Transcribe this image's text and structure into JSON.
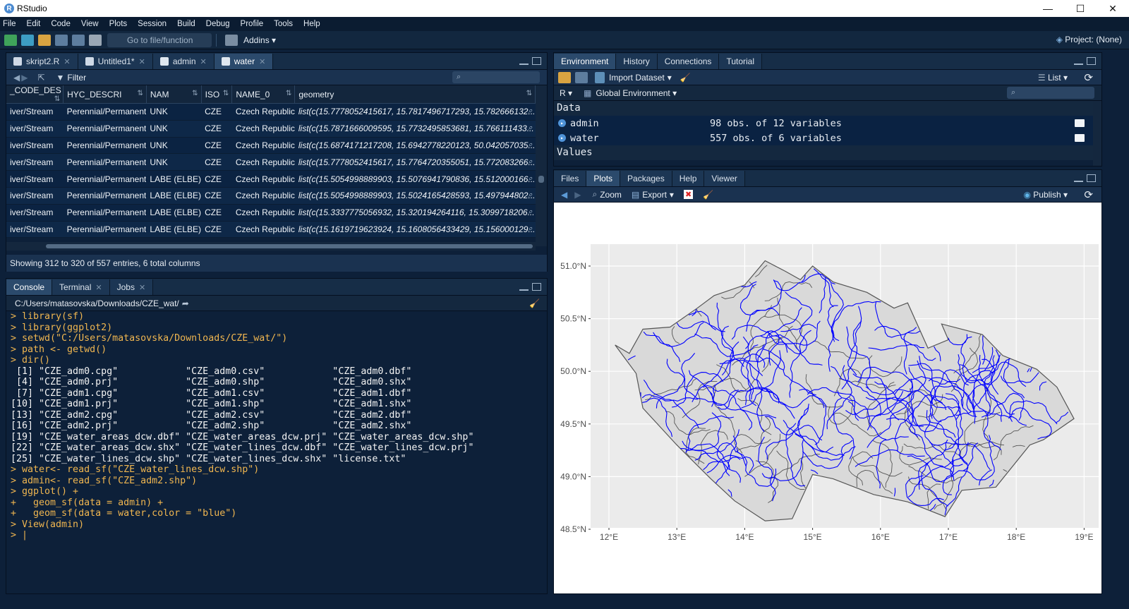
{
  "window": {
    "title": "RStudio",
    "controls": [
      "—",
      "☐",
      "✕"
    ]
  },
  "menu": [
    "File",
    "Edit",
    "Code",
    "View",
    "Plots",
    "Session",
    "Build",
    "Debug",
    "Profile",
    "Tools",
    "Help"
  ],
  "toolbar": {
    "goto_placeholder": "Go to file/function",
    "addins": "Addins",
    "project": "Project: (None)"
  },
  "source": {
    "tabs": [
      {
        "label": "skript2.R",
        "icon": "r-file-icon"
      },
      {
        "label": "Untitled1*",
        "icon": "r-file-icon"
      },
      {
        "label": "admin",
        "icon": "table-icon"
      },
      {
        "label": "water",
        "icon": "table-icon"
      }
    ],
    "active_tab": 3,
    "filter_label": "Filter",
    "columns": [
      "_CODE_DES",
      "HYC_DESCRI",
      "NAM",
      "ISO",
      "NAME_0",
      "geometry"
    ],
    "rows": [
      [
        "iver/Stream",
        "Perennial/Permanent",
        "UNK",
        "CZE",
        "Czech Republic",
        "list(c(15.7778052415617, 15.7817496717293, 15.782666132..."
      ],
      [
        "iver/Stream",
        "Perennial/Permanent",
        "UNK",
        "CZE",
        "Czech Republic",
        "list(c(15.7871666009595, 15.7732495853681, 15.766111433..."
      ],
      [
        "iver/Stream",
        "Perennial/Permanent",
        "UNK",
        "CZE",
        "Czech Republic",
        "list(c(15.6874171217208, 15.6942778220123, 50.042057035..."
      ],
      [
        "iver/Stream",
        "Perennial/Permanent",
        "UNK",
        "CZE",
        "Czech Republic",
        "list(c(15.7778052415617, 15.7764720355051, 15.772083266..."
      ],
      [
        "iver/Stream",
        "Perennial/Permanent",
        "LABE (ELBE)",
        "CZE",
        "Czech Republic",
        "list(c(15.5054998889903, 15.5076941790836, 15.512000166..."
      ],
      [
        "iver/Stream",
        "Perennial/Permanent",
        "LABE (ELBE)",
        "CZE",
        "Czech Republic",
        "list(c(15.5054998889903, 15.5024165428593, 15.497944802..."
      ],
      [
        "iver/Stream",
        "Perennial/Permanent",
        "LABE (ELBE)",
        "CZE",
        "Czech Republic",
        "list(c(15.3337775056932, 15.320194264116, 15.3099718206..."
      ],
      [
        "iver/Stream",
        "Perennial/Permanent",
        "LABE (ELBE)",
        "CZE",
        "Czech Republic",
        "list(c(15.1619719623924, 15.1608056433429, 15.156000129..."
      ]
    ],
    "status": "Showing 312 to 320 of 557 entries, 6 total columns"
  },
  "console": {
    "tabs": [
      "Console",
      "Terminal",
      "Jobs"
    ],
    "path": "C:/Users/matasovska/Downloads/CZE_wat/",
    "lines": [
      {
        "t": "cmd",
        "s": "> library(sf)"
      },
      {
        "t": "cmd",
        "s": "> library(ggplot2)"
      },
      {
        "t": "cmd",
        "s": "> setwd(\"C:/Users/matasovska/Downloads/CZE_wat/\")"
      },
      {
        "t": "cmd",
        "s": "> path <- getwd()"
      },
      {
        "t": "cmd",
        "s": "> dir()"
      },
      {
        "t": "out",
        "s": " [1] \"CZE_adm0.cpg\"            \"CZE_adm0.csv\"            \"CZE_adm0.dbf\""
      },
      {
        "t": "out",
        "s": " [4] \"CZE_adm0.prj\"            \"CZE_adm0.shp\"            \"CZE_adm0.shx\""
      },
      {
        "t": "out",
        "s": " [7] \"CZE_adm1.cpg\"            \"CZE_adm1.csv\"            \"CZE_adm1.dbf\""
      },
      {
        "t": "out",
        "s": "[10] \"CZE_adm1.prj\"            \"CZE_adm1.shp\"            \"CZE_adm1.shx\""
      },
      {
        "t": "out",
        "s": "[13] \"CZE_adm2.cpg\"            \"CZE_adm2.csv\"            \"CZE_adm2.dbf\""
      },
      {
        "t": "out",
        "s": "[16] \"CZE_adm2.prj\"            \"CZE_adm2.shp\"            \"CZE_adm2.shx\""
      },
      {
        "t": "out",
        "s": "[19] \"CZE_water_areas_dcw.dbf\" \"CZE_water_areas_dcw.prj\" \"CZE_water_areas_dcw.shp\""
      },
      {
        "t": "out",
        "s": "[22] \"CZE_water_areas_dcw.shx\" \"CZE_water_lines_dcw.dbf\" \"CZE_water_lines_dcw.prj\""
      },
      {
        "t": "out",
        "s": "[25] \"CZE_water_lines_dcw.shp\" \"CZE_water_lines_dcw.shx\" \"license.txt\""
      },
      {
        "t": "cmd",
        "s": "> water<- read_sf(\"CZE_water_lines_dcw.shp\")"
      },
      {
        "t": "cmd",
        "s": "> admin<- read_sf(\"CZE_adm2.shp\")"
      },
      {
        "t": "cmd",
        "s": "> ggplot() +"
      },
      {
        "t": "cmd",
        "s": "+   geom_sf(data = admin) +"
      },
      {
        "t": "cmd",
        "s": "+   geom_sf(data = water,color = \"blue\")"
      },
      {
        "t": "cmd",
        "s": "> View(admin)"
      },
      {
        "t": "cmd",
        "s": "> |"
      }
    ]
  },
  "environment": {
    "tabs": [
      "Environment",
      "History",
      "Connections",
      "Tutorial"
    ],
    "import_label": "Import Dataset",
    "list_label": "List",
    "lang": "R",
    "scope": "Global Environment",
    "section_data": "Data",
    "section_values": "Values",
    "items": [
      {
        "name": "admin",
        "desc": "98 obs. of 12 variables"
      },
      {
        "name": "water",
        "desc": "557 obs. of 6 variables"
      }
    ]
  },
  "files": {
    "tabs": [
      "Files",
      "Plots",
      "Packages",
      "Help",
      "Viewer"
    ],
    "active_tab": 1,
    "zoom_label": "Zoom",
    "export_label": "Export",
    "publish_label": "Publish"
  },
  "plot": {
    "y_labels": [
      "51.0°N",
      "50.5°N",
      "50.0°N",
      "49.5°N",
      "49.0°N",
      "48.5°N"
    ],
    "x_labels": [
      "12°E",
      "13°E",
      "14°E",
      "15°E",
      "16°E",
      "17°E",
      "18°E",
      "19°E"
    ],
    "panel_bg": "#ebebeb",
    "river_color": "#0000ff",
    "border_color": "#555555"
  }
}
